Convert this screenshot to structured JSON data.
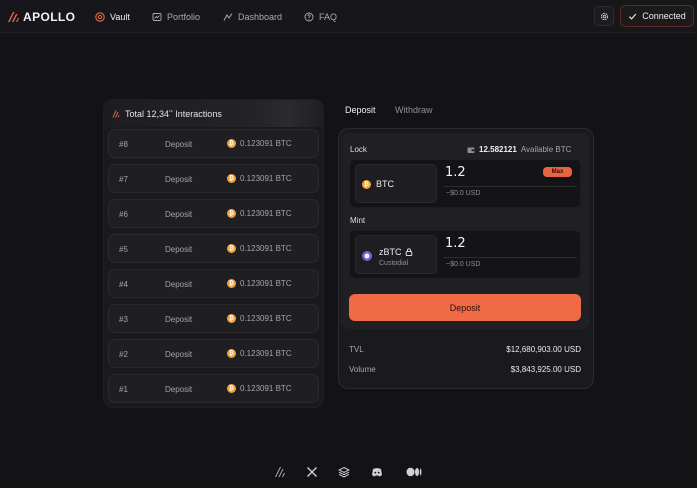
{
  "brand": {
    "name": "APOLLO",
    "accent": "#ef6a45"
  },
  "nav": [
    {
      "label": "Vault",
      "icon": "vault-icon",
      "active": true
    },
    {
      "label": "Portfolio",
      "icon": "portfolio-icon",
      "active": false
    },
    {
      "label": "Dashboard",
      "icon": "dashboard-icon",
      "active": false
    },
    {
      "label": "FAQ",
      "icon": "faq-icon",
      "active": false
    }
  ],
  "header": {
    "connected_label": "Connected"
  },
  "history": {
    "title": "Total 12,34",
    "title_super": "¹⁶",
    "title_tail": "Interactions",
    "rows": [
      {
        "id": "#8",
        "type": "Deposit",
        "amount": "0.123091 BTC"
      },
      {
        "id": "#7",
        "type": "Deposit",
        "amount": "0.123091 BTC"
      },
      {
        "id": "#6",
        "type": "Deposit",
        "amount": "0.123091 BTC"
      },
      {
        "id": "#5",
        "type": "Deposit",
        "amount": "0.123091 BTC"
      },
      {
        "id": "#4",
        "type": "Deposit",
        "amount": "0.123091 BTC"
      },
      {
        "id": "#3",
        "type": "Deposit",
        "amount": "0.123091 BTC"
      },
      {
        "id": "#2",
        "type": "Deposit",
        "amount": "0.123091 BTC"
      },
      {
        "id": "#1",
        "type": "Deposit",
        "amount": "0.123091 BTC"
      }
    ]
  },
  "tabs": {
    "deposit": "Deposit",
    "withdraw": "Withdraw"
  },
  "lock": {
    "label": "Lock",
    "available_value": "12.582121",
    "available_suffix": "Available BTC",
    "token": "BTC",
    "amount": "1.2",
    "usd": "~$0.0 USD",
    "max_label": "Max"
  },
  "mint": {
    "label": "Mint",
    "token": "zBTC",
    "token_sub": "Custodial",
    "amount": "1.2",
    "usd": "~$0.0 USD"
  },
  "deposit_button": "Deposit",
  "stats": {
    "tvl_label": "TVL",
    "tvl_value": "$12,680,903.00 USD",
    "volume_label": "Volume",
    "volume_value": "$3,843,925.00 USD"
  },
  "footer": {
    "icons": [
      "apollo-icon",
      "x-icon",
      "layers-icon",
      "discord-icon",
      "medium-icon"
    ]
  }
}
